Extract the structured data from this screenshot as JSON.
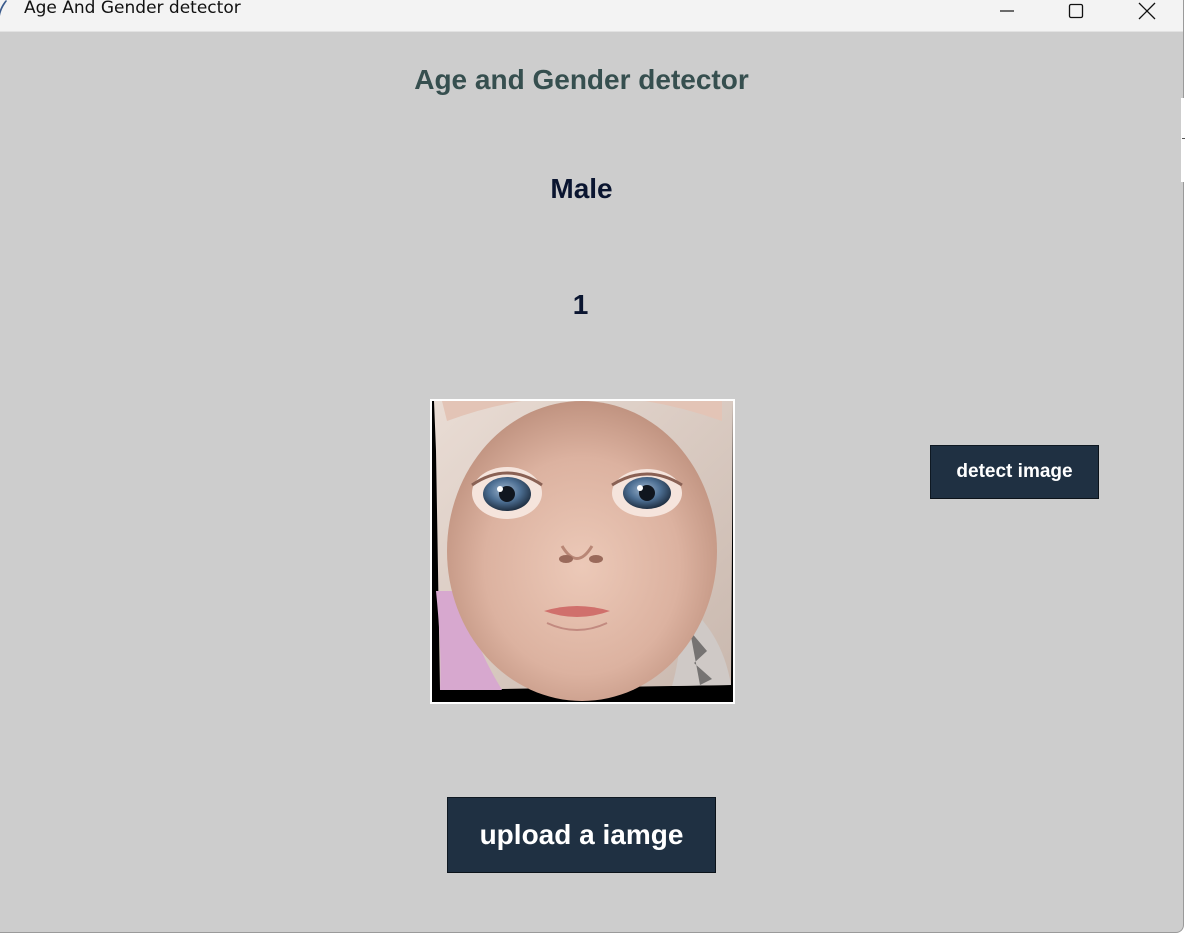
{
  "window": {
    "title": "Age And Gender detector",
    "controls": [
      "minimize-icon",
      "maximize-icon",
      "close-icon"
    ]
  },
  "main": {
    "heading": "Age and Gender detector",
    "gender_result": "Male",
    "age_result": "1",
    "image_alt": "uploaded baby face photo",
    "detect_button": "detect image",
    "upload_button": "upload a iamge"
  },
  "colors": {
    "background": "#cdcdcd",
    "heading": "#364f4f",
    "result_text": "#0a1530",
    "button_bg": "#1f3042",
    "button_text": "#ffffff"
  }
}
